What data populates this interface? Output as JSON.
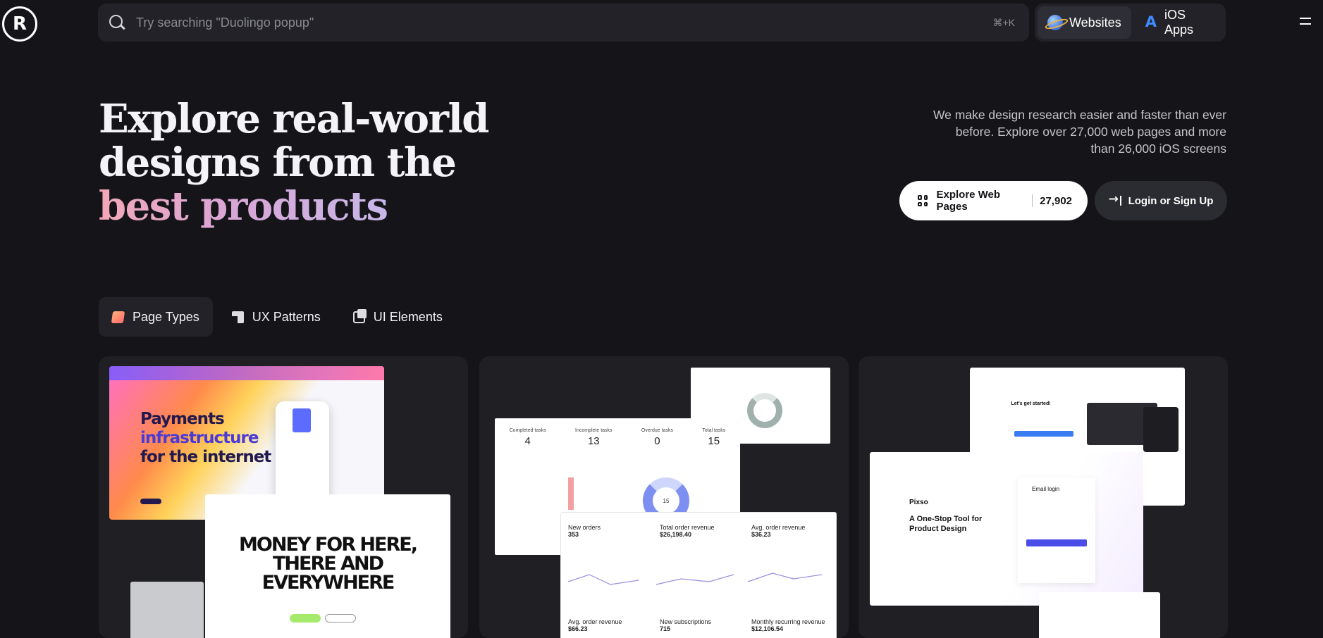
{
  "brand": {
    "logo_text": "R"
  },
  "search": {
    "placeholder": "Try searching \"Duolingo popup\"",
    "shortcut": "⌘+K"
  },
  "platform": {
    "websites_label": "Websites",
    "ios_label": "iOS Apps"
  },
  "hero": {
    "title_line1": "Explore real-world",
    "title_line2": "designs from the",
    "title_line3": "best products",
    "description": "We make design research easier and faster than ever before. Explore over 27,000 web pages and more than 26,000 iOS screens",
    "explore_label": "Explore Web Pages",
    "explore_count": "27,902",
    "login_label": "Login or Sign Up"
  },
  "tabs": [
    {
      "label": "Page Types"
    },
    {
      "label": "UX Patterns"
    },
    {
      "label": "UI Elements"
    }
  ],
  "cards": {
    "stripe": {
      "headline_1": "Payments",
      "headline_2": "infrastructure",
      "headline_3": "for the internet"
    },
    "money": {
      "headline": "MONEY FOR HERE, THERE AND EVERYWHERE"
    },
    "dashboard": {
      "stats": [
        {
          "label": "Completed tasks",
          "value": "4"
        },
        {
          "label": "Incomplete tasks",
          "value": "13"
        },
        {
          "label": "Overdue tasks",
          "value": "0"
        },
        {
          "label": "Total tasks",
          "value": "15"
        }
      ],
      "donut_value": "15",
      "kpis": [
        {
          "label": "New orders",
          "value": "353"
        },
        {
          "label": "Total order revenue",
          "value": "$26,198.40"
        },
        {
          "label": "Avg. order revenue",
          "value": "$36.23"
        }
      ],
      "kpis2": [
        {
          "label": "Avg. order revenue",
          "value": "$66.23"
        },
        {
          "label": "New subscriptions",
          "value": "715"
        },
        {
          "label": "Monthly recurring revenue",
          "value": "$12,106.54"
        }
      ]
    },
    "craft": {
      "title": "Let's get started!"
    },
    "pixso": {
      "logo": "Pixso",
      "headline": "A One-Stop Tool for Product Design",
      "form_title": "Email login"
    }
  },
  "colors": {
    "background": "#151519",
    "surface": "#222228",
    "accent_gradient_start": "#f3a8b8",
    "accent_gradient_end": "#c7b7e8"
  }
}
